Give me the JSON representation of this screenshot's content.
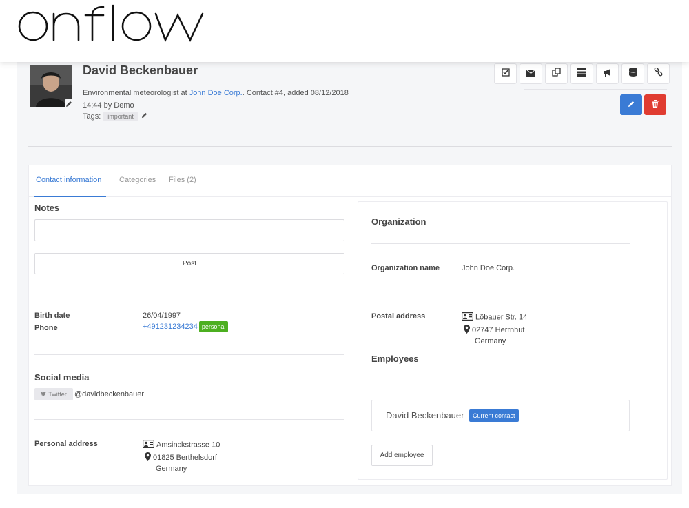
{
  "brand": {
    "logo_text": "onflow"
  },
  "contact": {
    "name": "David Beckenbauer",
    "meta_prefix": "Environmental meteorologist at ",
    "company": "John Doe Corp.",
    "meta_suffix": ". Contact #4, added 08/12/2018 14:44 by Demo",
    "tags_label": "Tags:",
    "tag": "important"
  },
  "toolbar": {
    "icons": [
      "checkbox-icon",
      "envelope-icon",
      "copy-icon",
      "list-icon",
      "megaphone-icon",
      "database-icon",
      "link-icon"
    ],
    "edit_icon": "pencil-icon",
    "delete_icon": "trash-icon",
    "primary_color": "#3a7bd5",
    "danger_color": "#e03c31"
  },
  "tabs": [
    {
      "label": "Contact information",
      "active": true
    },
    {
      "label": "Categories",
      "active": false
    },
    {
      "label": "Files (2)",
      "active": false
    }
  ],
  "notes": {
    "title": "Notes",
    "placeholder": "",
    "post_label": "Post"
  },
  "details": {
    "birth_label": "Birth date",
    "birth_value": "26/04/1997",
    "phone_label": "Phone",
    "phone_value": "+491231234234",
    "phone_badge": "personal",
    "badge_color": "#4caf20"
  },
  "social": {
    "title": "Social media",
    "network": "Twitter",
    "handle": "@davidbeckenbauer"
  },
  "personal_address": {
    "label": "Personal address",
    "street": "Amsinckstrasse 10",
    "city": "01825 Berthelsdorf",
    "country": "Germany"
  },
  "organization": {
    "title": "Organization",
    "name_label": "Organization name",
    "name_value": "John Doe Corp.",
    "postal_label": "Postal address",
    "street": "Löbauer Str. 14",
    "city": "02747 Herrnhut",
    "country": "Germany"
  },
  "employees": {
    "title": "Employees",
    "name": "David Beckenbauer",
    "badge": "Current contact",
    "add_label": "Add employee"
  }
}
